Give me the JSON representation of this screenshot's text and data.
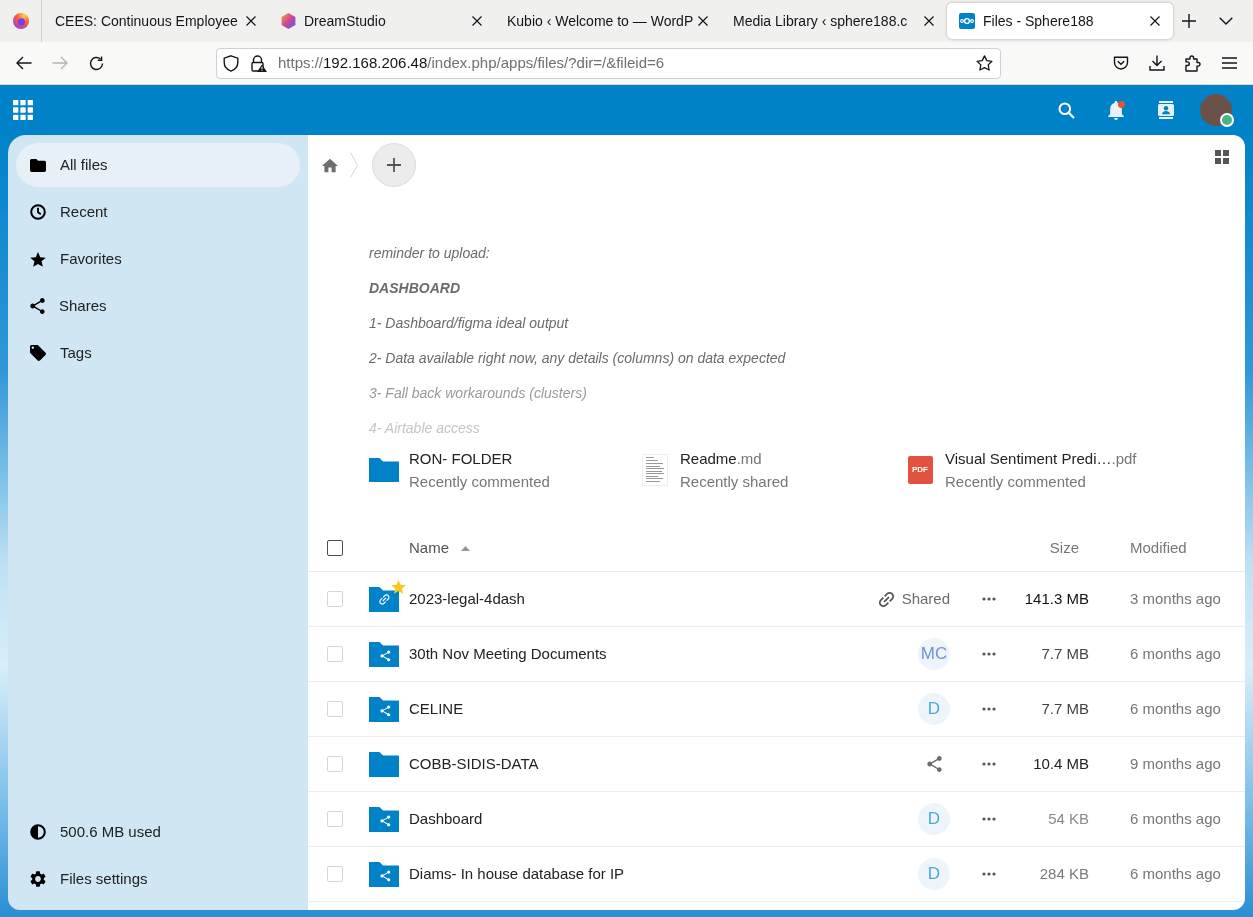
{
  "browser": {
    "tabs": [
      {
        "title": "CEES: Continuous Employee",
        "selected": false
      },
      {
        "title": "DreamStudio",
        "selected": false
      },
      {
        "title": "Kubio ‹ Welcome to — WordP",
        "selected": false
      },
      {
        "title": "Media Library ‹ sphere188.c",
        "selected": false
      },
      {
        "title": "Files - Sphere188",
        "selected": true
      }
    ],
    "nav": [
      {
        "kind": "back",
        "disabled": false
      },
      {
        "kind": "forward",
        "disabled": true
      },
      {
        "kind": "reload",
        "disabled": false
      }
    ],
    "address": {
      "scheme": "https://",
      "host": "192.168.206.48",
      "path": "/index.php/apps/files/?dir=/&fileid=6"
    }
  },
  "header": {
    "notifications": {
      "unread": true
    },
    "user": {
      "online": true
    }
  },
  "sidebar": {
    "items": [
      {
        "label": "All files",
        "selected": true
      },
      {
        "label": "Recent",
        "selected": false
      },
      {
        "label": "Favorites",
        "selected": false
      },
      {
        "label": "Shares",
        "selected": false
      },
      {
        "label": "Tags",
        "selected": false
      }
    ],
    "footer": [
      {
        "kind": "quota",
        "label": "500.6 MB used"
      },
      {
        "kind": "settings",
        "label": "Files settings"
      }
    ]
  },
  "note": {
    "lines": [
      {
        "kind": "text",
        "text": "reminder to upload:"
      },
      {
        "kind": "heading",
        "text": "DASHBOARD"
      },
      {
        "kind": "text",
        "text": "1- Dashboard/figma ideal output"
      },
      {
        "kind": "text",
        "text": "2- Data available right now, any details (columns) on data expected"
      },
      {
        "kind": "text",
        "text": "3- Fall back workarounds (clusters)"
      },
      {
        "kind": "text",
        "text": "4- Airtable access"
      }
    ]
  },
  "recommendations": [
    {
      "kind": "folder",
      "name": "RON- FOLDER",
      "reason": "Recently commented"
    },
    {
      "kind": "text",
      "name": "Readme",
      "extension": ".md",
      "reason": "Recently shared"
    },
    {
      "kind": "pdf",
      "badge": "PDF",
      "name": "Visual Sentiment Predi…",
      "extension": ".pdf",
      "reason": "Recently commented"
    }
  ],
  "table": {
    "select_all": {
      "checked": false
    },
    "columns": [
      {
        "label": "Name",
        "sorted": true
      },
      {
        "label": "Size",
        "sorted": false
      },
      {
        "label": "Modified",
        "sorted": false
      }
    ],
    "rows": [
      {
        "name": "2023-legal-4dash",
        "checked": false,
        "favorite": true,
        "share": {
          "kind": "link",
          "label": "Shared"
        },
        "size": {
          "text": "141.3 MB",
          "color": "#111111"
        },
        "modified": "3 months ago"
      },
      {
        "name": "30th Nov Meeting Documents",
        "checked": false,
        "favorite": false,
        "share": {
          "kind": "user",
          "initials": "MC",
          "color": "#6f93d3"
        },
        "size": {
          "text": "7.7 MB",
          "color": "#444444"
        },
        "modified": "6 months ago"
      },
      {
        "name": "CELINE",
        "checked": false,
        "favorite": false,
        "share": {
          "kind": "user",
          "initials": "D",
          "color": "#4ea8d2"
        },
        "size": {
          "text": "7.7 MB",
          "color": "#444444"
        },
        "modified": "6 months ago"
      },
      {
        "name": "COBB-SIDIS-DATA",
        "checked": false,
        "favorite": false,
        "share": {
          "kind": "none"
        },
        "size": {
          "text": "10.4 MB",
          "color": "#222222"
        },
        "modified": "9 months ago"
      },
      {
        "name": "Dashboard",
        "checked": false,
        "favorite": false,
        "share": {
          "kind": "user",
          "initials": "D",
          "color": "#4ea8d2"
        },
        "size": {
          "text": "54 KB",
          "color": "#8a8a8a"
        },
        "modified": "6 months ago"
      },
      {
        "name": "Diams- In house database for IP",
        "checked": false,
        "favorite": false,
        "share": {
          "kind": "user",
          "initials": "D",
          "color": "#4ea8d2"
        },
        "size": {
          "text": "284 KB",
          "color": "#7a7a7a"
        },
        "modified": "6 months ago"
      }
    ]
  }
}
